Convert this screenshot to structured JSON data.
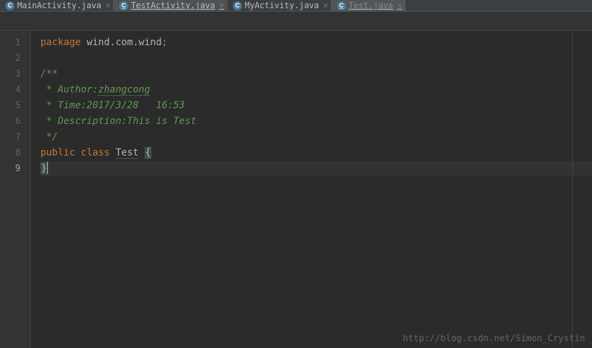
{
  "tabs": [
    {
      "label": "MainActivity.java",
      "active": false
    },
    {
      "label": "TestActivity.java",
      "active": true
    },
    {
      "label": "MyActivity.java",
      "active": false
    },
    {
      "label": "Test.java",
      "active": true,
      "current": true
    }
  ],
  "gutter": {
    "lines": [
      "1",
      "2",
      "3",
      "4",
      "5",
      "6",
      "7",
      "8",
      "9"
    ],
    "current_line": 9,
    "fold_open_at": 3,
    "fold_close_at": 7
  },
  "code": {
    "line1": {
      "kw": "package",
      "pkg": " wind.com.wind",
      "semi": ";"
    },
    "line3": "/**",
    "line4_prefix": " * Author:",
    "line4_author": "zhangcong",
    "line5": " * Time:2017/3/28   16:53",
    "line6": " * Description:This is Test",
    "line7": " */",
    "line8": {
      "public": "public",
      "class": "class",
      "name": "Test",
      "brace": "{"
    },
    "line9": "}"
  },
  "watermark": "http://blog.csdn.net/Simon_Crystin"
}
